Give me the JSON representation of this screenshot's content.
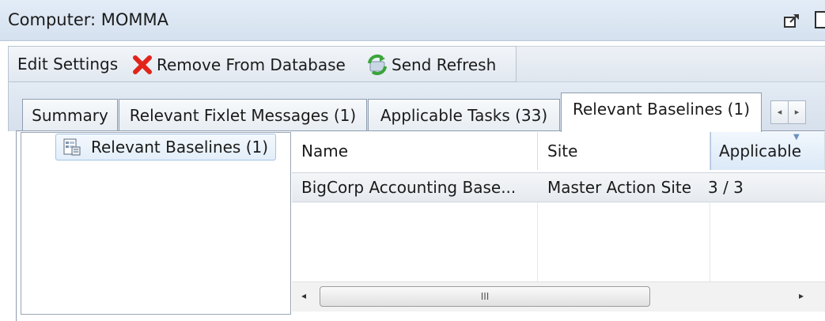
{
  "window": {
    "title": "Computer: MOMMA"
  },
  "toolbar": {
    "edit_settings": "Edit Settings",
    "remove_from_database": "Remove From Database",
    "send_refresh": "Send Refresh"
  },
  "tabs": [
    {
      "label": "Summary",
      "active": false
    },
    {
      "label": "Relevant Fixlet Messages (1)",
      "active": false
    },
    {
      "label": "Applicable Tasks (33)",
      "active": false
    },
    {
      "label": "Relevant Baselines (1)",
      "active": true
    }
  ],
  "tab_scroll": {
    "left": "◂",
    "right": "▸"
  },
  "tree": {
    "item_label": "Relevant Baselines (1)"
  },
  "table": {
    "columns": [
      "Name",
      "Site",
      "Applicable"
    ],
    "sorted_column": "Applicable",
    "rows": [
      {
        "name": "BigCorp Accounting Base...",
        "site": "Master Action Site",
        "applicable": "3 / 3"
      }
    ]
  },
  "scrollbar": {
    "left": "◂",
    "grip": "III",
    "right": "▸"
  },
  "icons": {
    "remove": "remove-x-icon",
    "refresh": "refresh-icon",
    "baseline": "baseline-icon",
    "popout": "popout-icon",
    "restore": "restore-window-icon"
  },
  "colors": {
    "titlebar": "#dbe5f1",
    "remove_red": "#e2231a",
    "refresh_green": "#3aa53a",
    "selection_border": "#a5c3e4"
  }
}
